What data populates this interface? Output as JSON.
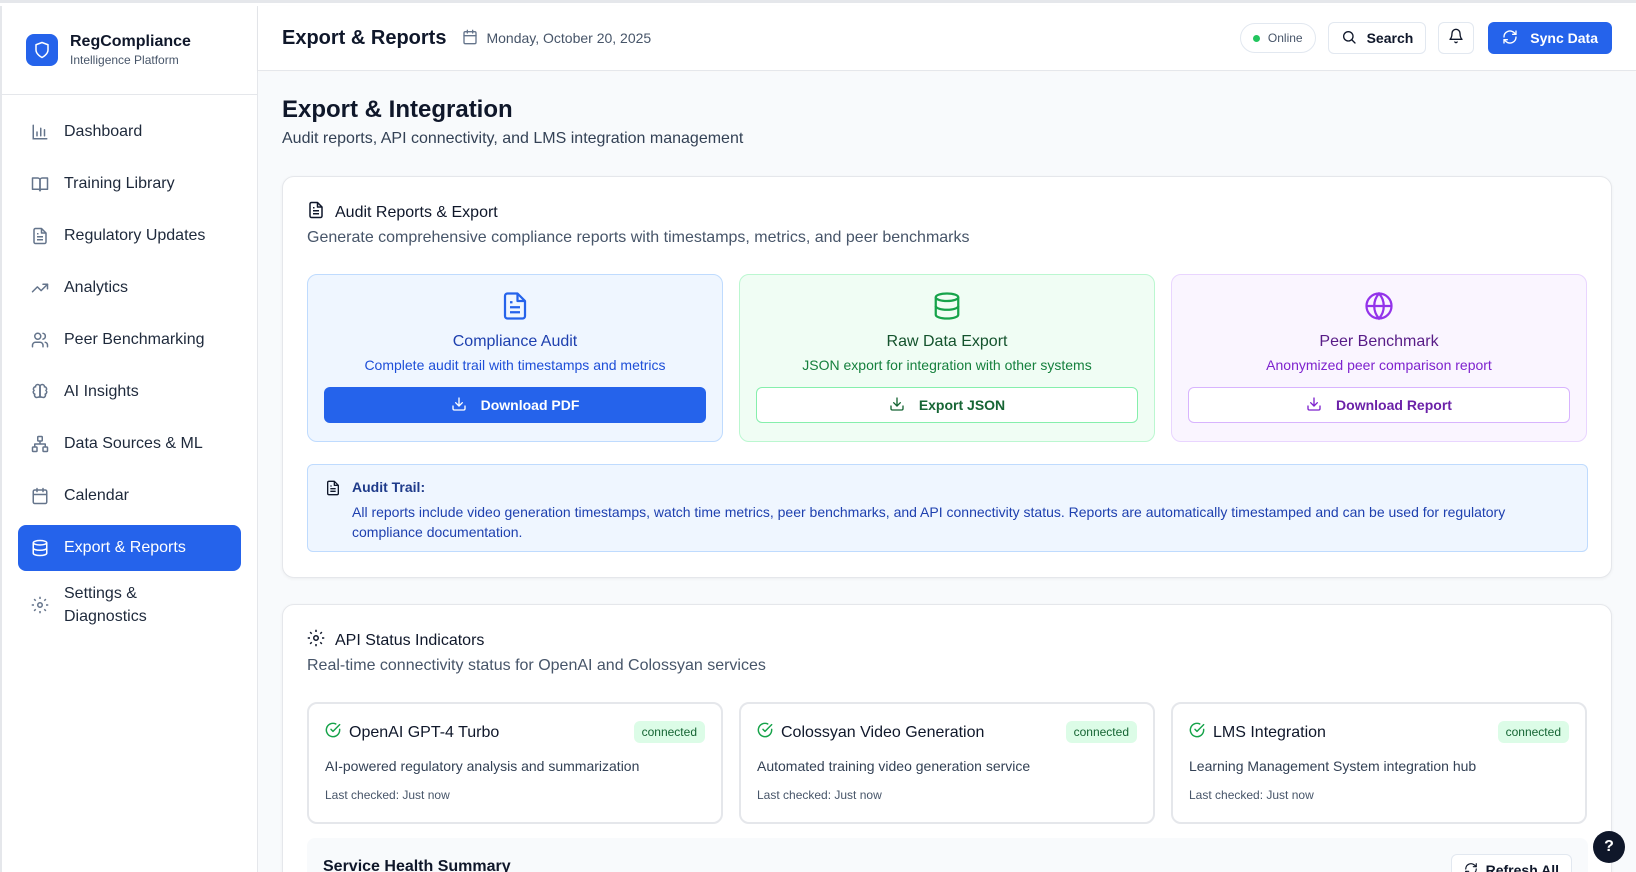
{
  "brand": {
    "title": "RegCompliance",
    "subtitle": "Intelligence Platform",
    "icon": "shield-icon"
  },
  "sidebar": {
    "items": [
      {
        "label": "Dashboard",
        "icon": "bar-chart-icon",
        "active": false
      },
      {
        "label": "Training Library",
        "icon": "book-open-icon",
        "active": false
      },
      {
        "label": "Regulatory Updates",
        "icon": "file-text-icon",
        "active": false
      },
      {
        "label": "Analytics",
        "icon": "trending-up-icon",
        "active": false
      },
      {
        "label": "Peer Benchmarking",
        "icon": "users-icon",
        "active": false
      },
      {
        "label": "AI Insights",
        "icon": "brain-icon",
        "active": false
      },
      {
        "label": "Data Sources & ML",
        "icon": "network-icon",
        "active": false
      },
      {
        "label": "Calendar",
        "icon": "calendar-icon",
        "active": false
      },
      {
        "label": "Export & Reports",
        "icon": "database-icon",
        "active": true
      },
      {
        "label": "Settings & Diagnostics",
        "icon": "gear-icon",
        "active": false
      }
    ]
  },
  "topbar": {
    "title": "Export & Reports",
    "date": "Monday, October 20, 2025",
    "status": "Online",
    "search_label": "Search",
    "sync_label": "Sync Data"
  },
  "page": {
    "title": "Export & Integration",
    "subtitle": "Audit reports, API connectivity, and LMS integration management"
  },
  "audit_card": {
    "title": "Audit Reports & Export",
    "description": "Generate comprehensive compliance reports with timestamps, metrics, and peer benchmarks",
    "tiles": [
      {
        "title": "Compliance Audit",
        "description": "Complete audit trail with timestamps and metrics",
        "button": "Download PDF",
        "icon": "file-text-icon"
      },
      {
        "title": "Raw Data Export",
        "description": "JSON export for integration with other systems",
        "button": "Export JSON",
        "icon": "database-icon"
      },
      {
        "title": "Peer Benchmark",
        "description": "Anonymized peer comparison report",
        "button": "Download Report",
        "icon": "globe-icon"
      }
    ],
    "audit_trail": {
      "title": "Audit Trail:",
      "text": "All reports include video generation timestamps, watch time metrics, peer benchmarks, and API connectivity status. Reports are automatically timestamped and can be used for regulatory compliance documentation."
    }
  },
  "api_card": {
    "title": "API Status Indicators",
    "description": "Real-time connectivity status for OpenAI and Colossyan services",
    "services": [
      {
        "name": "OpenAI GPT-4 Turbo",
        "status": "connected",
        "description": "AI-powered regulatory analysis and summarization",
        "last_checked": "Last checked: Just now"
      },
      {
        "name": "Colossyan Video Generation",
        "status": "connected",
        "description": "Automated training video generation service",
        "last_checked": "Last checked: Just now"
      },
      {
        "name": "LMS Integration",
        "status": "connected",
        "description": "Learning Management System integration hub",
        "last_checked": "Last checked: Just now"
      }
    ],
    "health_title": "Service Health Summary",
    "refresh_label": "Refresh All"
  },
  "help": {
    "label": "?"
  },
  "colors": {
    "accent": "#2563eb",
    "success": "#22c55e"
  }
}
